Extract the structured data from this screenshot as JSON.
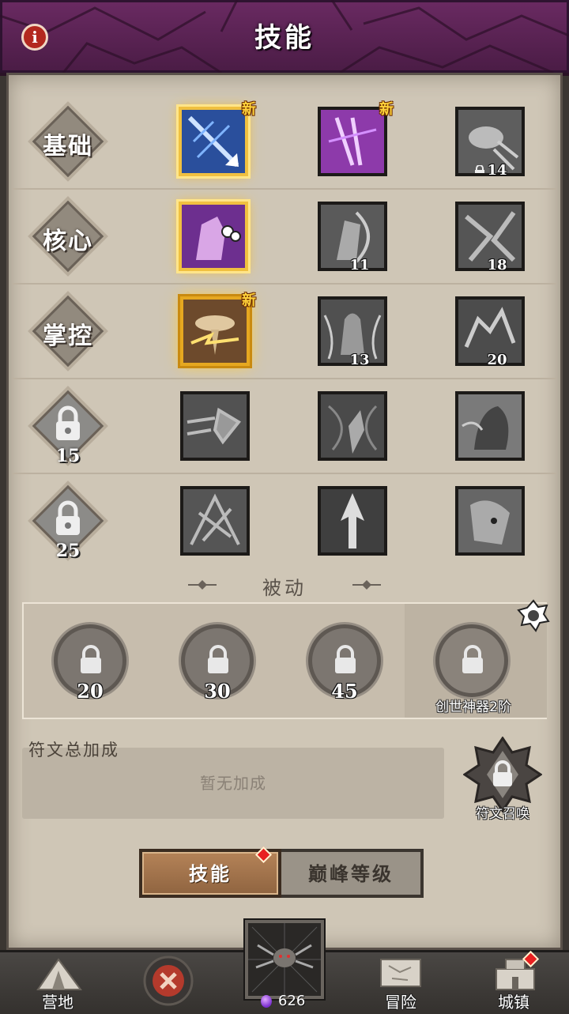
{
  "header": {
    "title": "技能",
    "info_icon": "info-icon"
  },
  "rows": [
    {
      "label": "基础",
      "locked": false,
      "skills": [
        {
          "icon": "blue-arrow-skill-icon",
          "state": "selected",
          "new": "新"
        },
        {
          "icon": "purple-arrows-skill-icon",
          "state": "unlocked",
          "new": "新"
        },
        {
          "icon": "bird-skill-icon",
          "state": "locked",
          "level": "14"
        }
      ]
    },
    {
      "label": "核心",
      "locked": false,
      "skills": [
        {
          "icon": "purple-ghost-skill-icon",
          "state": "selected"
        },
        {
          "icon": "archer-skill-icon",
          "state": "locked",
          "level": "11"
        },
        {
          "icon": "blades-skill-icon",
          "state": "locked",
          "level": "18"
        }
      ]
    },
    {
      "label": "掌控",
      "locked": false,
      "skills": [
        {
          "icon": "lightning-mushroom-skill-icon",
          "state": "selected-glow",
          "new": "新"
        },
        {
          "icon": "hooded-figure-skill-icon",
          "state": "locked",
          "level": "13"
        },
        {
          "icon": "wolf-skill-icon",
          "state": "locked",
          "level": "20"
        }
      ]
    },
    {
      "label": "",
      "locked": true,
      "level": "15",
      "skills": [
        {
          "icon": "dash-skill-icon",
          "state": "unavailable"
        },
        {
          "icon": "whirlwind-skill-icon",
          "state": "unavailable"
        },
        {
          "icon": "shadow-skill-icon",
          "state": "unavailable"
        }
      ]
    },
    {
      "label": "",
      "locked": true,
      "level": "25",
      "skills": [
        {
          "icon": "thorns-skill-icon",
          "state": "unavailable"
        },
        {
          "icon": "arrow-up-skill-icon",
          "state": "unavailable"
        },
        {
          "icon": "beast-skill-icon",
          "state": "unavailable"
        }
      ]
    }
  ],
  "passive": {
    "title": "被动",
    "slots": [
      "20",
      "30",
      "45"
    ],
    "artifact_label": "创世神器2阶"
  },
  "rune": {
    "title": "符文总加成",
    "empty_text": "暂无加成",
    "summon_label": "符文召唤"
  },
  "tabs": {
    "active": "技能",
    "inactive": "巅峰等级"
  },
  "bottom_nav": {
    "camp": "营地",
    "adventure": "冒险",
    "town": "城镇",
    "currency": "626"
  },
  "colors": {
    "accent_gold": "#f0c040",
    "header_purple": "#5a2252",
    "red_dot": "#e82020"
  }
}
